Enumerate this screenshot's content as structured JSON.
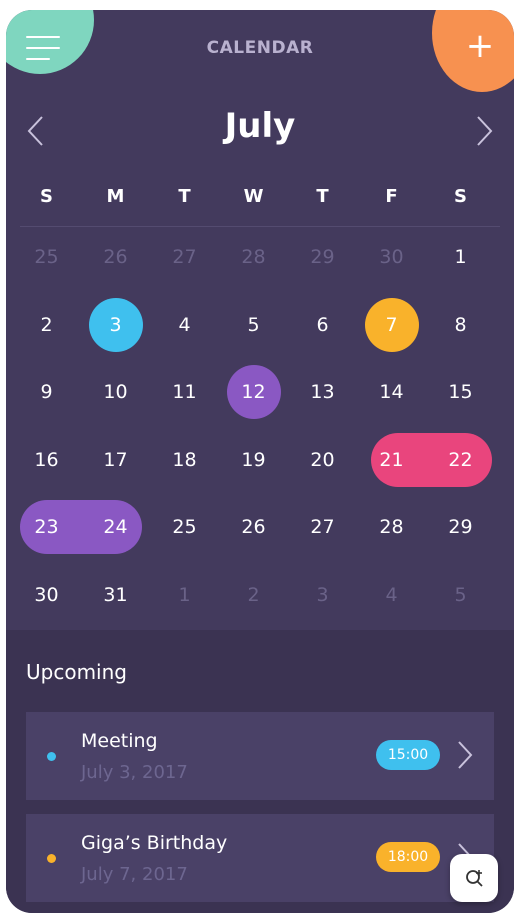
{
  "header": {
    "title": "CALENDAR",
    "month": "July"
  },
  "colors": {
    "background": "#433a5d",
    "menu_blob": "#7fd6bf",
    "add_blob": "#f79150",
    "blue": "#3fc0ee",
    "yellow": "#f9b22b",
    "purple": "#8a58c3",
    "pink": "#e9457d"
  },
  "weekdays": [
    "S",
    "M",
    "T",
    "W",
    "T",
    "F",
    "S"
  ],
  "weeks": [
    [
      "25",
      "26",
      "27",
      "28",
      "29",
      "30",
      "1"
    ],
    [
      "2",
      "3",
      "4",
      "5",
      "6",
      "7",
      "8"
    ],
    [
      "9",
      "10",
      "11",
      "12",
      "13",
      "14",
      "15"
    ],
    [
      "16",
      "17",
      "18",
      "19",
      "20",
      "21",
      "22"
    ],
    [
      "23",
      "24",
      "25",
      "26",
      "27",
      "28",
      "29"
    ],
    [
      "30",
      "31",
      "1",
      "2",
      "3",
      "4",
      "5"
    ]
  ],
  "upcoming": {
    "title": "Upcoming",
    "events": [
      {
        "title": "Meeting",
        "date": "July 3, 2017",
        "time": "15:00",
        "color": "#3fc0ee"
      },
      {
        "title": "Giga’s Birthday",
        "date": "July 7, 2017",
        "time": "18:00",
        "color": "#f9b22b"
      }
    ]
  },
  "icons": {
    "menu": "hamburger-menu-icon",
    "add": "plus-icon",
    "prev": "chevron-left-icon",
    "next": "chevron-right-icon",
    "event_arrow": "chevron-right-icon",
    "floating": "refresh-search-icon"
  }
}
